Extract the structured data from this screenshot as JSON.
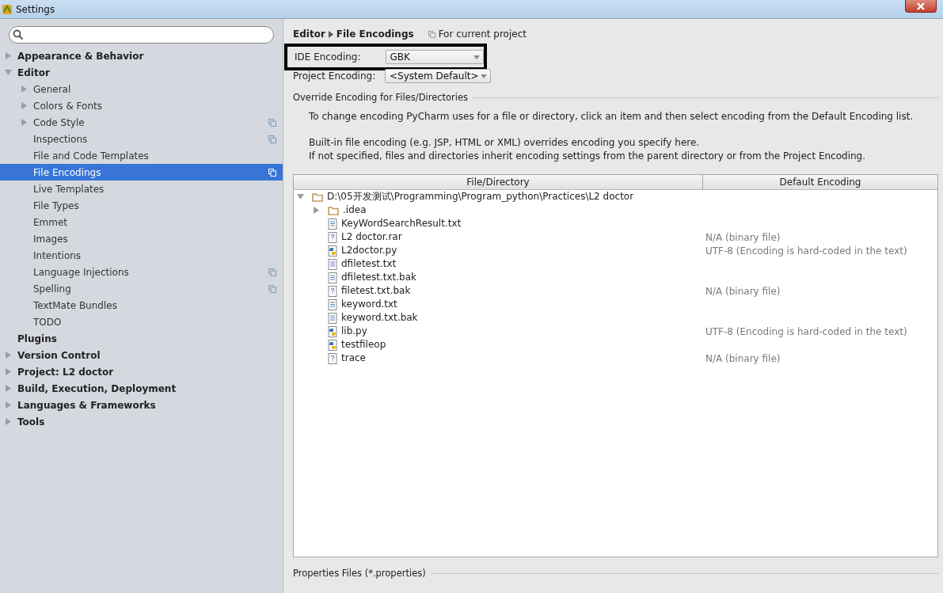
{
  "window": {
    "title": "Settings"
  },
  "sidebar": {
    "items": [
      {
        "label": "Appearance & Behavior",
        "expanded": false,
        "selected": false,
        "scoped": false
      },
      {
        "label": "Editor",
        "expanded": true,
        "selected": false,
        "scoped": false,
        "children": [
          {
            "label": "General",
            "expanded": false,
            "selected": false,
            "scoped": false
          },
          {
            "label": "Colors & Fonts",
            "expanded": false,
            "selected": false,
            "scoped": false
          },
          {
            "label": "Code Style",
            "expanded": false,
            "selected": false,
            "scoped": true
          },
          {
            "label": "Inspections",
            "selected": false,
            "scoped": true
          },
          {
            "label": "File and Code Templates",
            "selected": false,
            "scoped": false
          },
          {
            "label": "File Encodings",
            "selected": true,
            "scoped": true
          },
          {
            "label": "Live Templates",
            "selected": false,
            "scoped": false
          },
          {
            "label": "File Types",
            "selected": false,
            "scoped": false
          },
          {
            "label": "Emmet",
            "selected": false,
            "scoped": false
          },
          {
            "label": "Images",
            "selected": false,
            "scoped": false
          },
          {
            "label": "Intentions",
            "selected": false,
            "scoped": false
          },
          {
            "label": "Language Injections",
            "selected": false,
            "scoped": true
          },
          {
            "label": "Spelling",
            "selected": false,
            "scoped": true
          },
          {
            "label": "TextMate Bundles",
            "selected": false,
            "scoped": false
          },
          {
            "label": "TODO",
            "selected": false,
            "scoped": false
          }
        ]
      },
      {
        "label": "Plugins",
        "selected": false,
        "scoped": false
      },
      {
        "label": "Version Control",
        "expanded": false,
        "selected": false,
        "scoped": false
      },
      {
        "label": "Project: L2 doctor",
        "expanded": false,
        "selected": false,
        "scoped": false
      },
      {
        "label": "Build, Execution, Deployment",
        "expanded": false,
        "selected": false,
        "scoped": false
      },
      {
        "label": "Languages & Frameworks",
        "expanded": false,
        "selected": false,
        "scoped": false
      },
      {
        "label": "Tools",
        "expanded": false,
        "selected": false,
        "scoped": false
      }
    ]
  },
  "breadcrumb": {
    "parent": "Editor",
    "current": "File Encodings",
    "scope": "For current project"
  },
  "ide_encoding": {
    "label": "IDE Encoding:",
    "value": "GBK",
    "highlighted": true
  },
  "project_encoding": {
    "label": "Project Encoding:",
    "value": "<System Default>"
  },
  "override": {
    "title": "Override Encoding for Files/Directories",
    "paragraphs": [
      [
        "To change encoding PyCharm uses for a file or directory, click an item and then select encoding from the Default Encoding list."
      ],
      [
        "Built-in file encoding (e.g. JSP, HTML or XML) overrides encoding you specify here.",
        "If not specified, files and directories inherit encoding settings from the parent directory or from the Project Encoding."
      ]
    ]
  },
  "table": {
    "columns": [
      "File/Directory",
      "Default Encoding"
    ],
    "rows": [
      {
        "name": "D:\\05开发测试\\Programming\\Program_python\\Practices\\L2 doctor",
        "kind": "folder",
        "expanded": true,
        "children": [
          {
            "name": ".idea",
            "kind": "folder",
            "expanded": false
          },
          {
            "name": "KeyWordSearchResult.txt",
            "kind": "text"
          },
          {
            "name": "L2 doctor.rar",
            "kind": "unknown",
            "encoding": "N/A (binary file)"
          },
          {
            "name": "L2doctor.py",
            "kind": "python",
            "encoding": "UTF-8 (Encoding is hard-coded in the text)"
          },
          {
            "name": "dfiletest.txt",
            "kind": "text"
          },
          {
            "name": "dfiletest.txt.bak",
            "kind": "text"
          },
          {
            "name": "filetest.txt.bak",
            "kind": "unknown",
            "encoding": "N/A (binary file)"
          },
          {
            "name": "keyword.txt",
            "kind": "text"
          },
          {
            "name": "keyword.txt.bak",
            "kind": "text"
          },
          {
            "name": "lib.py",
            "kind": "python",
            "encoding": "UTF-8 (Encoding is hard-coded in the text)"
          },
          {
            "name": "testfileop",
            "kind": "python"
          },
          {
            "name": "trace",
            "kind": "unknown",
            "encoding": "N/A (binary file)"
          }
        ]
      }
    ]
  },
  "properties": {
    "title": "Properties Files (*.properties)"
  }
}
